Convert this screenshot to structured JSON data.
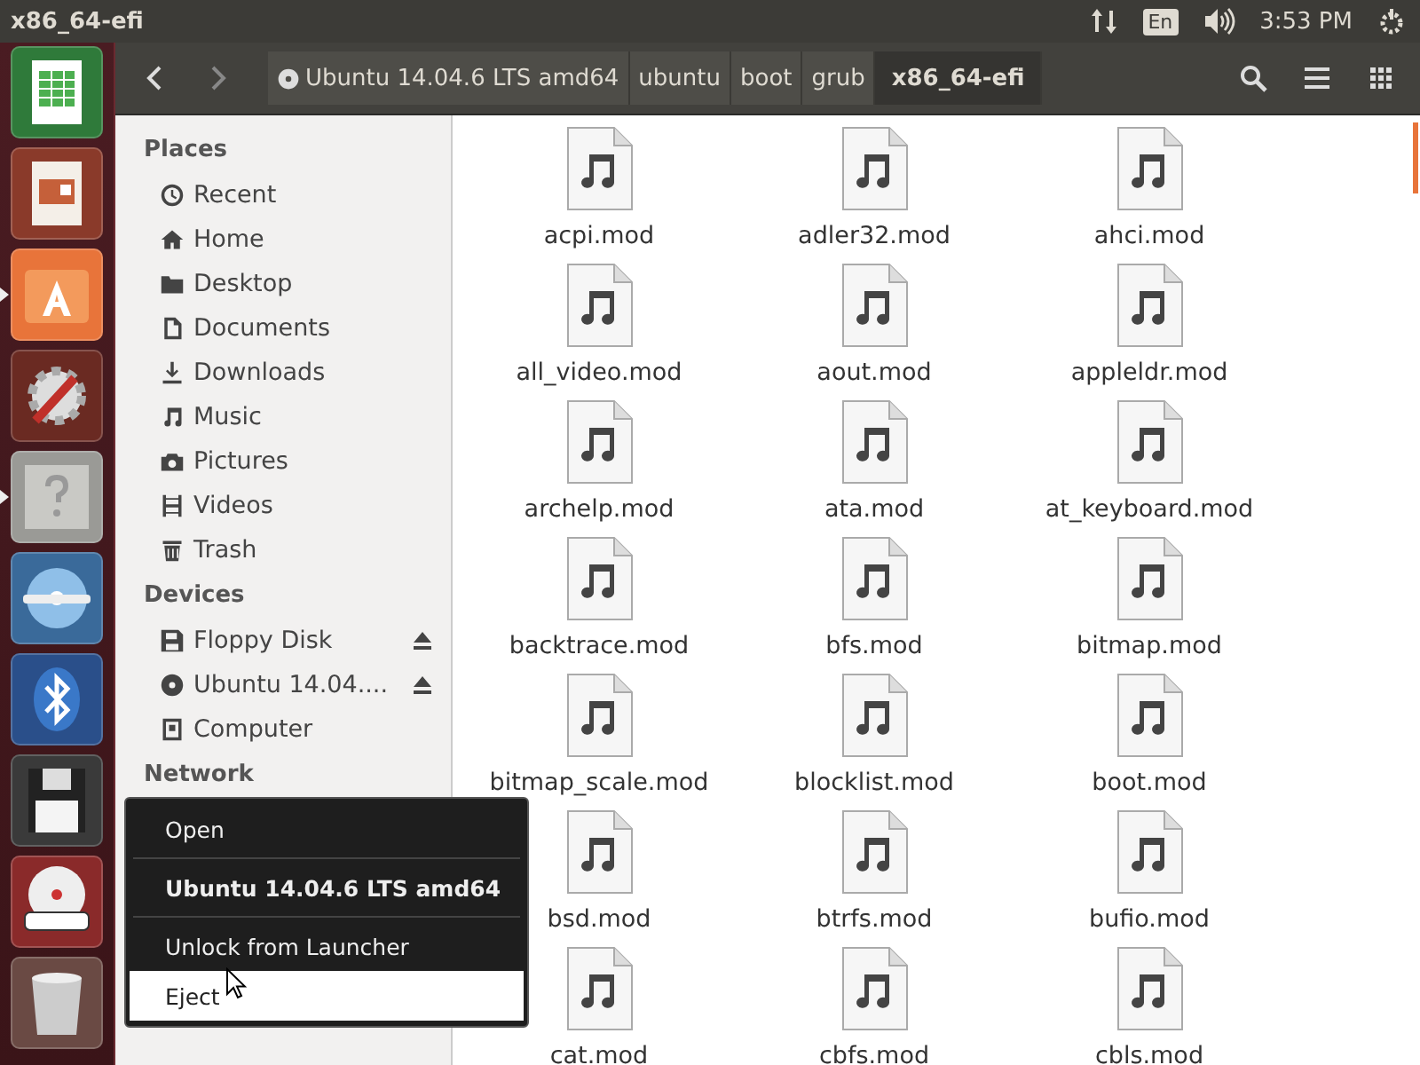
{
  "top_panel": {
    "title": "x86_64-efi",
    "language": "En",
    "time": "3:53 PM"
  },
  "launcher": [
    {
      "kind": "spreadsheet",
      "running": false
    },
    {
      "kind": "presentation",
      "running": false
    },
    {
      "kind": "store",
      "running": true
    },
    {
      "kind": "settings",
      "running": false
    },
    {
      "kind": "help",
      "running": true
    },
    {
      "kind": "disc",
      "running": false
    },
    {
      "kind": "bluetooth",
      "running": false
    },
    {
      "kind": "floppy",
      "running": false
    },
    {
      "kind": "dvd",
      "running": false
    },
    {
      "kind": "trash",
      "running": false
    }
  ],
  "path_bar": [
    {
      "label": "Ubuntu 14.04.6 LTS amd64",
      "kind": "disc",
      "selected": false
    },
    {
      "label": "ubuntu",
      "kind": "folder",
      "selected": false
    },
    {
      "label": "boot",
      "kind": "folder",
      "selected": false
    },
    {
      "label": "grub",
      "kind": "folder",
      "selected": false
    },
    {
      "label": "x86_64-efi",
      "kind": "folder",
      "selected": true
    }
  ],
  "sidebar": [
    {
      "heading": "Places",
      "items": [
        {
          "label": "Recent"
        },
        {
          "label": "Home"
        },
        {
          "label": "Desktop"
        },
        {
          "label": "Documents"
        },
        {
          "label": "Downloads"
        },
        {
          "label": "Music"
        },
        {
          "label": "Pictures"
        },
        {
          "label": "Videos"
        },
        {
          "label": "Trash"
        }
      ]
    },
    {
      "heading": "Devices",
      "items": [
        {
          "label": "Floppy Disk",
          "eject": true
        },
        {
          "label": "Ubuntu 14.04....",
          "eject": true
        },
        {
          "label": "Computer",
          "eject": false
        }
      ]
    },
    {
      "heading": "Network"
    }
  ],
  "files": [
    "acpi.mod",
    "adler32.mod",
    "ahci.mod",
    "all_video.mod",
    "aout.mod",
    "appleldr.mod",
    "archelp.mod",
    "ata.mod",
    "at_keyboard.mod",
    "backtrace.mod",
    "bfs.mod",
    "bitmap.mod",
    "bitmap_scale.mod",
    "blocklist.mod",
    "boot.mod",
    "bsd.mod",
    "btrfs.mod",
    "bufio.mod",
    "cat.mod",
    "cbfs.mod",
    "cbls.mod"
  ],
  "context_menu": [
    {
      "label": "Open",
      "kind": "item",
      "selected": false
    },
    {
      "label": "Ubuntu 14.04.6 LTS amd64",
      "kind": "title",
      "selected": false
    },
    {
      "label": "Unlock from Launcher",
      "kind": "item",
      "selected": false
    },
    {
      "label": "Eject",
      "kind": "item",
      "selected": true
    }
  ]
}
